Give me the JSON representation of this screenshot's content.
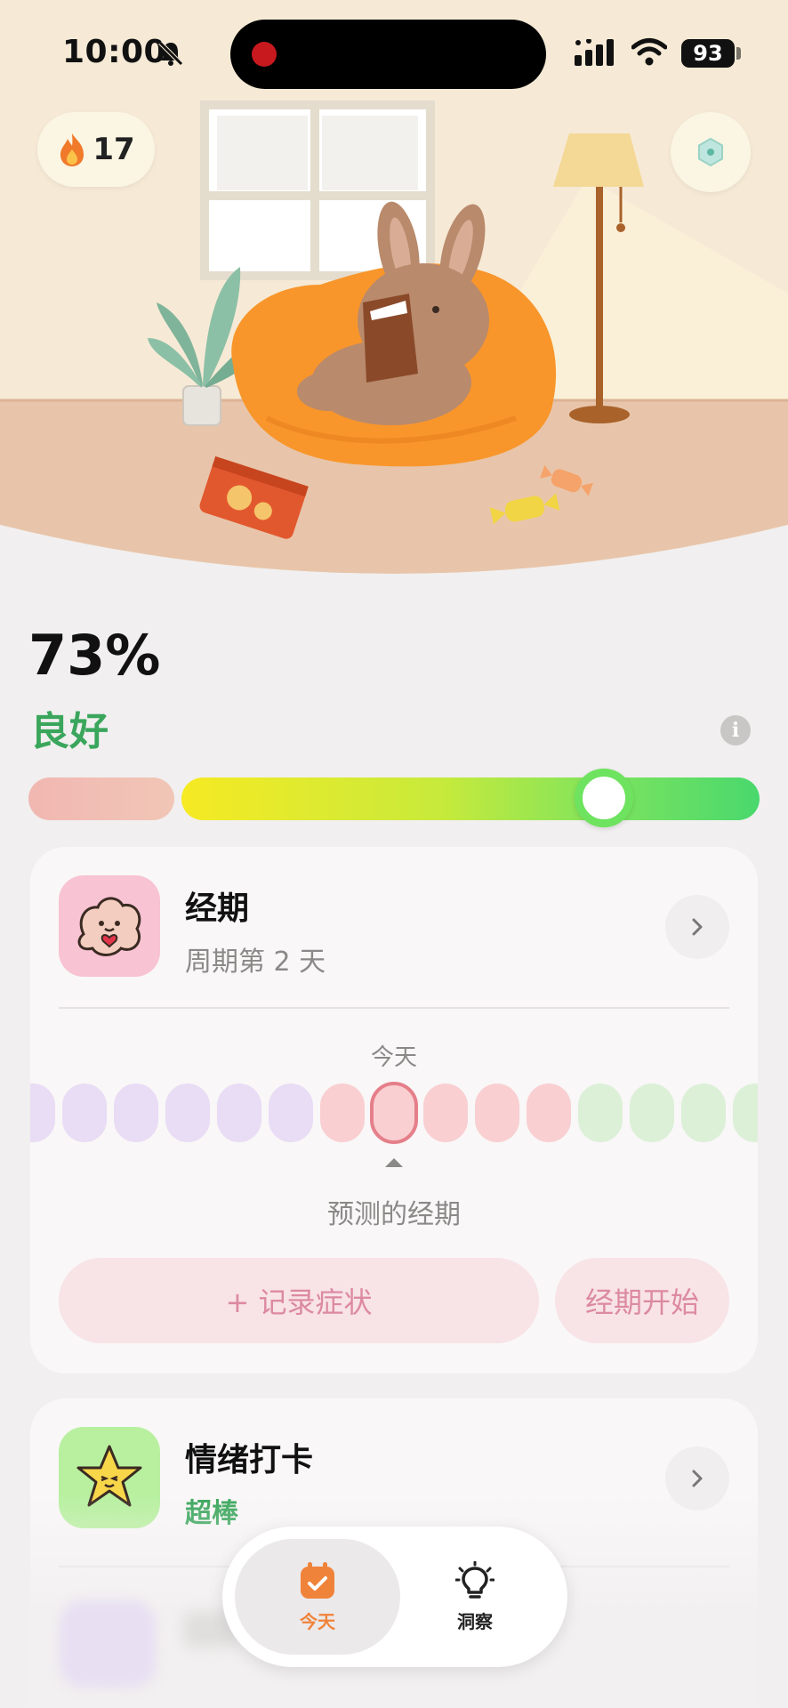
{
  "status_bar": {
    "time": "10:00",
    "battery": "93",
    "icons": [
      "bell-muted-icon",
      "cellular-signal-icon",
      "wifi-icon",
      "battery-icon"
    ]
  },
  "hero": {
    "streak_count": "17",
    "streak_icon": "flame-icon",
    "settings_icon": "hexagon-settings-icon",
    "illustration": "bunny-reading-on-beanbag"
  },
  "score": {
    "percent": "73%",
    "status": "良好",
    "level": 0.73,
    "colors": {
      "good": "#3aa65c",
      "low": "#f1b7b2",
      "knob": "#6ee35f"
    }
  },
  "period_card": {
    "title": "经期",
    "subtitle": "周期第 2 天",
    "today_label": "今天",
    "predicted_label": "预测的经期",
    "record_button": "+  记录症状",
    "start_button": "经期开始",
    "day_types": [
      "purple",
      "purple",
      "purple",
      "purple",
      "purple",
      "purple",
      "pink",
      "today",
      "pink",
      "pink",
      "pink",
      "green",
      "green",
      "green",
      "green"
    ]
  },
  "mood_card": {
    "title": "情绪打卡",
    "subtitle": "超棒"
  },
  "tab_bar": {
    "tabs": [
      {
        "label": "今天",
        "icon": "calendar-check-icon",
        "active": true
      },
      {
        "label": "洞察",
        "icon": "lightbulb-icon",
        "active": false
      }
    ],
    "accent": "#f0833a"
  }
}
